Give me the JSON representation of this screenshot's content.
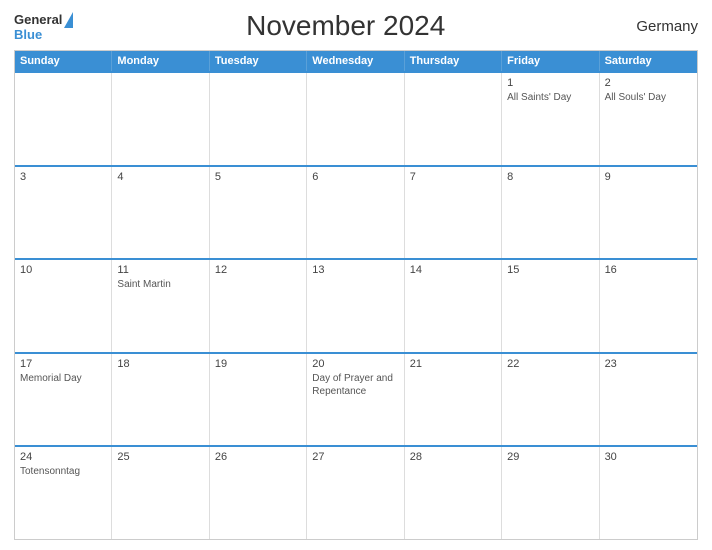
{
  "header": {
    "logo_general": "General",
    "logo_blue": "Blue",
    "title": "November 2024",
    "country": "Germany"
  },
  "weekdays": [
    "Sunday",
    "Monday",
    "Tuesday",
    "Wednesday",
    "Thursday",
    "Friday",
    "Saturday"
  ],
  "weeks": [
    [
      {
        "day": "",
        "event": ""
      },
      {
        "day": "",
        "event": ""
      },
      {
        "day": "",
        "event": ""
      },
      {
        "day": "",
        "event": ""
      },
      {
        "day": "",
        "event": ""
      },
      {
        "day": "1",
        "event": "All Saints' Day"
      },
      {
        "day": "2",
        "event": "All Souls' Day"
      }
    ],
    [
      {
        "day": "3",
        "event": ""
      },
      {
        "day": "4",
        "event": ""
      },
      {
        "day": "5",
        "event": ""
      },
      {
        "day": "6",
        "event": ""
      },
      {
        "day": "7",
        "event": ""
      },
      {
        "day": "8",
        "event": ""
      },
      {
        "day": "9",
        "event": ""
      }
    ],
    [
      {
        "day": "10",
        "event": ""
      },
      {
        "day": "11",
        "event": "Saint Martin"
      },
      {
        "day": "12",
        "event": ""
      },
      {
        "day": "13",
        "event": ""
      },
      {
        "day": "14",
        "event": ""
      },
      {
        "day": "15",
        "event": ""
      },
      {
        "day": "16",
        "event": ""
      }
    ],
    [
      {
        "day": "17",
        "event": "Memorial Day"
      },
      {
        "day": "18",
        "event": ""
      },
      {
        "day": "19",
        "event": ""
      },
      {
        "day": "20",
        "event": "Day of Prayer and Repentance"
      },
      {
        "day": "21",
        "event": ""
      },
      {
        "day": "22",
        "event": ""
      },
      {
        "day": "23",
        "event": ""
      }
    ],
    [
      {
        "day": "24",
        "event": "Totensonntag"
      },
      {
        "day": "25",
        "event": ""
      },
      {
        "day": "26",
        "event": ""
      },
      {
        "day": "27",
        "event": ""
      },
      {
        "day": "28",
        "event": ""
      },
      {
        "day": "29",
        "event": ""
      },
      {
        "day": "30",
        "event": ""
      }
    ]
  ]
}
